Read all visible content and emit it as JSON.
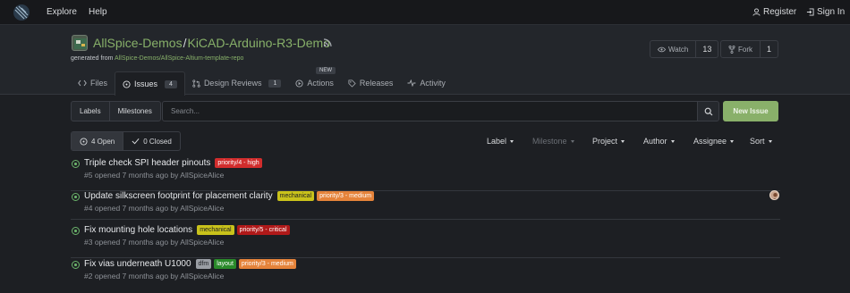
{
  "topnav": {
    "explore": "Explore",
    "help": "Help",
    "register": "Register",
    "signin": "Sign In"
  },
  "repo": {
    "owner": "AllSpice-Demos",
    "separator": "/",
    "name": "KiCAD-Arduino-R3-Demo",
    "generated_prefix": "generated from",
    "generated_link": "AllSpice-Demos/AllSpice-Altium-template-repo",
    "watch_label": "Watch",
    "watch_count": "13",
    "fork_label": "Fork",
    "fork_count": "1"
  },
  "tabs": [
    {
      "label": "Files",
      "icon": "code-icon"
    },
    {
      "label": "Issues",
      "icon": "issue-icon",
      "count": "4"
    },
    {
      "label": "Design Reviews",
      "icon": "pull-request-icon",
      "count": "1"
    },
    {
      "label": "Actions",
      "icon": "play-icon"
    },
    {
      "label": "Releases",
      "icon": "tag-icon"
    },
    {
      "label": "Activity",
      "icon": "pulse-icon"
    }
  ],
  "new_badge": "NEW",
  "toolbar": {
    "labels": "Labels",
    "milestones": "Milestones",
    "search_placeholder": "Search...",
    "new_issue": "New Issue"
  },
  "state": {
    "open": "4 Open",
    "closed": "0 Closed"
  },
  "filters": {
    "label": "Label",
    "milestone": "Milestone",
    "project": "Project",
    "author": "Author",
    "assignee": "Assignee",
    "sort": "Sort"
  },
  "issues": [
    {
      "title": "Triple check SPI header pinouts",
      "meta": "#5 opened 7 months ago by AllSpiceAlice",
      "labels": [
        {
          "text": "priority/4 - high",
          "bg": "#d22d2d",
          "fg": "#ffffff"
        }
      ]
    },
    {
      "title": "Update silkscreen footprint for placement clarity",
      "meta": "#4 opened 7 months ago by AllSpiceAlice",
      "labels": [
        {
          "text": "mechanical",
          "bg": "#c9c21b",
          "fg": "#1d1f23"
        },
        {
          "text": "priority/3 - medium",
          "bg": "#e5833a",
          "fg": "#ffffff"
        }
      ]
    },
    {
      "title": "Fix mounting hole locations",
      "meta": "#3 opened 7 months ago by AllSpiceAlice",
      "labels": [
        {
          "text": "mechanical",
          "bg": "#c9c21b",
          "fg": "#1d1f23"
        },
        {
          "text": "priority/5 - critical",
          "bg": "#b01919",
          "fg": "#ffffff"
        }
      ]
    },
    {
      "title": "Fix vias underneath U1000",
      "meta": "#2 opened 7 months ago by AllSpiceAlice",
      "labels": [
        {
          "text": "dfm",
          "bg": "#9a9ea4",
          "fg": "#1d1f23"
        },
        {
          "text": "layout",
          "bg": "#2a8a2a",
          "fg": "#ffffff"
        },
        {
          "text": "priority/3 - medium",
          "bg": "#e5833a",
          "fg": "#ffffff"
        }
      ]
    }
  ]
}
